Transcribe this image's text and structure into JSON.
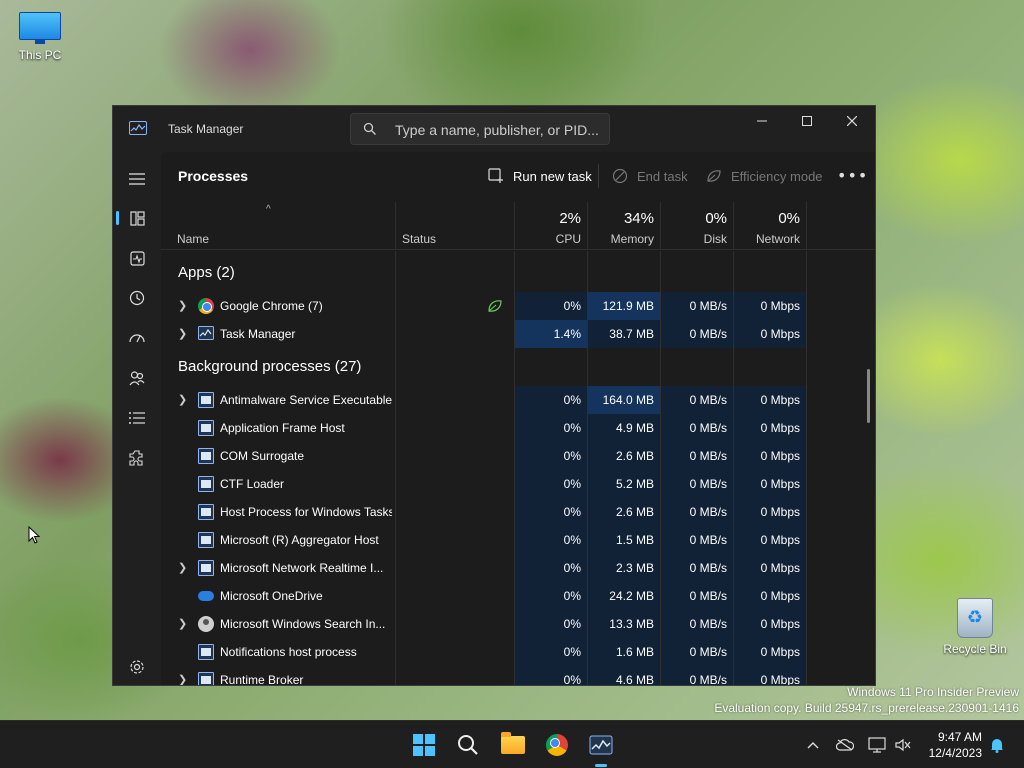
{
  "desktop": {
    "this_pc_label": "This PC",
    "recycle_bin_label": "Recycle Bin",
    "watermark_line1": "Windows 11 Pro Insider Preview",
    "watermark_line2": "Evaluation copy. Build 25947.rs_prerelease.230901-1416"
  },
  "window": {
    "title": "Task Manager",
    "search_placeholder": "Type a name, publisher, or PID...",
    "controls": [
      "minimize-icon",
      "maximize-icon",
      "close-icon"
    ]
  },
  "nav": {
    "items": [
      {
        "name": "hamburger-menu-icon"
      },
      {
        "name": "processes-icon",
        "active": true
      },
      {
        "name": "performance-icon"
      },
      {
        "name": "app-history-icon"
      },
      {
        "name": "startup-apps-icon"
      },
      {
        "name": "users-icon"
      },
      {
        "name": "details-icon"
      },
      {
        "name": "services-icon"
      },
      {
        "name": "settings-icon"
      }
    ]
  },
  "commandbar": {
    "page_title": "Processes",
    "run_new_task": "Run new task",
    "end_task": "End task",
    "efficiency_mode": "Efficiency mode",
    "more": "•••"
  },
  "header": {
    "name": "Name",
    "status": "Status",
    "cpu_pct": "2%",
    "cpu": "CPU",
    "memory_pct": "34%",
    "memory": "Memory",
    "disk_pct": "0%",
    "disk": "Disk",
    "network_pct": "0%",
    "network": "Network"
  },
  "groups": {
    "apps": "Apps (2)",
    "background": "Background processes (27)"
  },
  "apps": [
    {
      "name": "Google Chrome (7)",
      "icon": "chrome-icon",
      "expandable": true,
      "efficiency": true,
      "cpu": "0%",
      "memory": "121.9 MB",
      "disk": "0 MB/s",
      "network": "0 Mbps"
    },
    {
      "name": "Task Manager",
      "icon": "task-manager-icon",
      "expandable": true,
      "efficiency": false,
      "cpu": "1.4%",
      "memory": "38.7 MB",
      "disk": "0 MB/s",
      "network": "0 Mbps"
    }
  ],
  "background": [
    {
      "name": "Antimalware Service Executable",
      "icon": "process-icon",
      "expandable": true,
      "cpu": "0%",
      "memory": "164.0 MB",
      "disk": "0 MB/s",
      "network": "0 Mbps"
    },
    {
      "name": "Application Frame Host",
      "icon": "process-icon",
      "expandable": false,
      "cpu": "0%",
      "memory": "4.9 MB",
      "disk": "0 MB/s",
      "network": "0 Mbps"
    },
    {
      "name": "COM Surrogate",
      "icon": "process-icon",
      "expandable": false,
      "cpu": "0%",
      "memory": "2.6 MB",
      "disk": "0 MB/s",
      "network": "0 Mbps"
    },
    {
      "name": "CTF Loader",
      "icon": "process-icon",
      "expandable": false,
      "cpu": "0%",
      "memory": "5.2 MB",
      "disk": "0 MB/s",
      "network": "0 Mbps"
    },
    {
      "name": "Host Process for Windows Tasks",
      "icon": "process-icon",
      "expandable": false,
      "cpu": "0%",
      "memory": "2.6 MB",
      "disk": "0 MB/s",
      "network": "0 Mbps"
    },
    {
      "name": "Microsoft (R) Aggregator Host",
      "icon": "process-icon",
      "expandable": false,
      "cpu": "0%",
      "memory": "1.5 MB",
      "disk": "0 MB/s",
      "network": "0 Mbps"
    },
    {
      "name": "Microsoft Network Realtime I...",
      "icon": "process-icon",
      "expandable": true,
      "cpu": "0%",
      "memory": "2.3 MB",
      "disk": "0 MB/s",
      "network": "0 Mbps"
    },
    {
      "name": "Microsoft OneDrive",
      "icon": "onedrive-icon",
      "expandable": false,
      "cpu": "0%",
      "memory": "24.2 MB",
      "disk": "0 MB/s",
      "network": "0 Mbps"
    },
    {
      "name": "Microsoft Windows Search In...",
      "icon": "search-indexer-icon",
      "expandable": true,
      "cpu": "0%",
      "memory": "13.3 MB",
      "disk": "0 MB/s",
      "network": "0 Mbps"
    },
    {
      "name": "Notifications host process",
      "icon": "process-icon",
      "expandable": false,
      "cpu": "0%",
      "memory": "1.6 MB",
      "disk": "0 MB/s",
      "network": "0 Mbps"
    },
    {
      "name": "Runtime Broker",
      "icon": "process-icon",
      "expandable": true,
      "cpu": "0%",
      "memory": "4.6 MB",
      "disk": "0 MB/s",
      "network": "0 Mbps"
    }
  ],
  "taskbar": {
    "apps": [
      "start-icon",
      "search-icon",
      "file-explorer-icon",
      "chrome-icon",
      "task-manager-icon"
    ],
    "time": "9:47 AM",
    "date": "12/4/2023"
  },
  "colors": {
    "accent": "#4cc2ff",
    "heat_low": "#112136",
    "heat_mid": "#14345e",
    "window_bg": "#202020"
  }
}
